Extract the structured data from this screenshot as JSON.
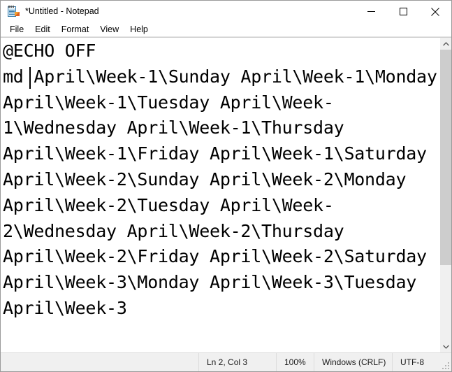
{
  "window": {
    "title": "*Untitled - Notepad",
    "icon": "notepad-icon",
    "controls": {
      "minimize_label": "Minimize",
      "maximize_label": "Maximize",
      "close_label": "Close"
    }
  },
  "menubar": {
    "items": [
      {
        "label": "File"
      },
      {
        "label": "Edit"
      },
      {
        "label": "Format"
      },
      {
        "label": "View"
      },
      {
        "label": "Help"
      }
    ]
  },
  "editor": {
    "text": "@ECHO OFF\nmd April\\Week-1\\Sunday April\\Week-1\\Monday April\\Week-1\\Tuesday April\\Week-1\\Wednesday April\\Week-1\\Thursday April\\Week-1\\Friday April\\Week-1\\Saturday April\\Week-2\\Sunday April\\Week-2\\Monday April\\Week-2\\Tuesday April\\Week-2\\Wednesday April\\Week-2\\Thursday April\\Week-2\\Friday April\\Week-2\\Saturday April\\Week-3\\Monday April\\Week-3\\Tuesday April\\Week-3",
    "visible_lines": [
      "@ECHO OFF",
      "md April\\Week-1\\Sunday April",
      "\\Week-1\\Monday April\\Week-",
      "1\\Tuesday April\\Week-1\\Wednesday",
      "April\\Week-1\\Thursday April\\Week-",
      "1\\Friday April\\Week-1\\Saturday",
      "April\\Week-2\\Sunday April\\Week-",
      "2\\Monday April\\Week-2\\Tuesday",
      "April\\Week-2\\Wednesday April",
      "\\Week-2\\Thursday April\\Week-",
      "2\\Friday April\\Week-2\\Saturday",
      "April\\Week-3\\Monday April\\Week-"
    ],
    "caret": {
      "line": 2,
      "column": 3
    }
  },
  "scrollbar": {
    "up_arrow": "chevron-up-icon",
    "down_arrow": "chevron-down-icon",
    "thumb_top_percent": 0,
    "thumb_height_percent": 74
  },
  "statusbar": {
    "cursor_position": "Ln 2, Col 3",
    "zoom": "100%",
    "line_ending": "Windows (CRLF)",
    "encoding": "UTF-8"
  },
  "colors": {
    "window_bg": "#ffffff",
    "chrome_bg": "#f0f0f0",
    "text": "#000000",
    "scrollbar_thumb": "#cdcdcd",
    "border": "#9a9a9a"
  }
}
